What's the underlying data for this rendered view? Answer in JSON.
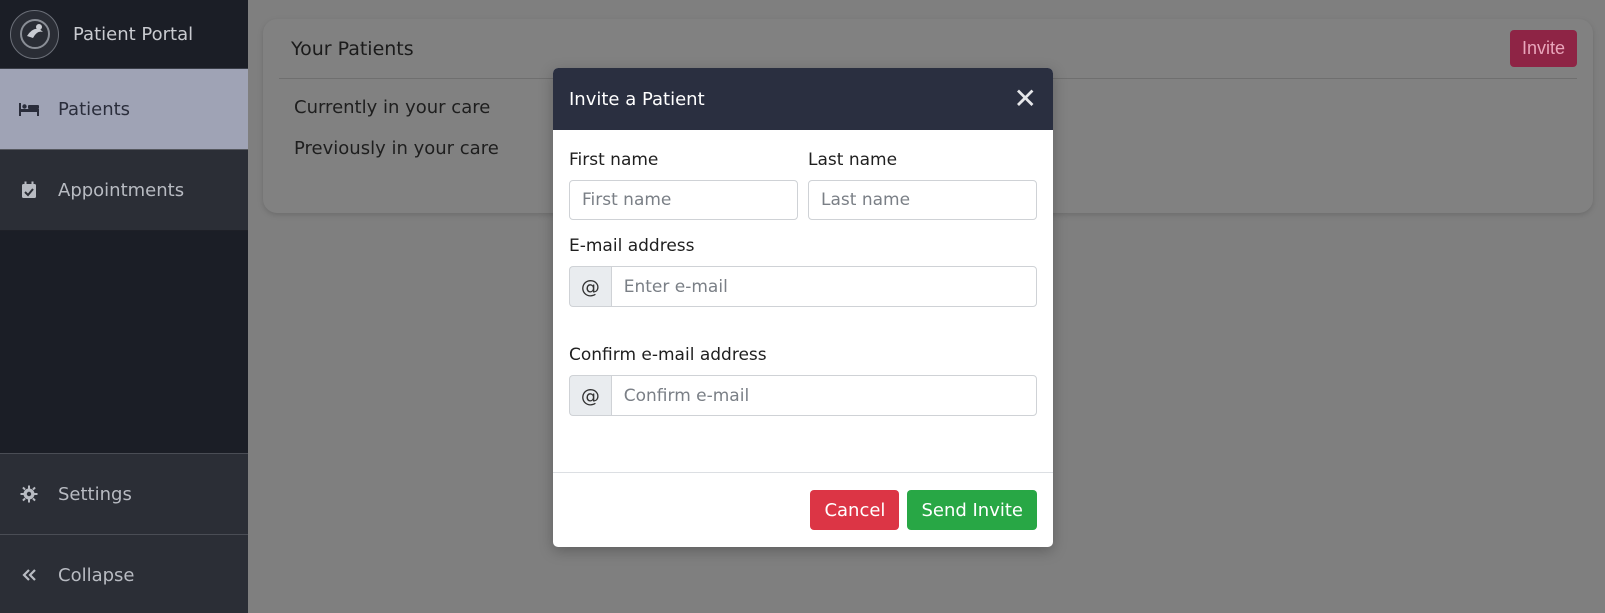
{
  "sidebar": {
    "brand_title": "Patient Portal",
    "items": [
      {
        "label": "Patients",
        "icon": "bed-icon"
      },
      {
        "label": "Appointments",
        "icon": "calendar-check-icon"
      }
    ],
    "bottom_items": [
      {
        "label": "Settings",
        "icon": "gear-icon"
      },
      {
        "label": "Collapse",
        "icon": "double-chevron-left-icon"
      }
    ]
  },
  "main": {
    "title": "Your Patients",
    "invite_label": "Invite",
    "care_items": [
      "Currently in your care",
      "Previously in your care"
    ]
  },
  "modal": {
    "title": "Invite a Patient",
    "first_name_label": "First name",
    "first_name_placeholder": "First name",
    "last_name_label": "Last name",
    "last_name_placeholder": "Last name",
    "email_label": "E-mail address",
    "email_prefix": "@",
    "email_placeholder": "Enter e-mail",
    "confirm_label": "Confirm e-mail address",
    "confirm_prefix": "@",
    "confirm_placeholder": "Confirm e-mail",
    "cancel_label": "Cancel",
    "send_label": "Send Invite"
  },
  "colors": {
    "sidebar_bg": "#1b1e26",
    "modal_header_bg": "#2a2f40",
    "invite_btn": "#8e2445",
    "cancel_btn": "#dc3545",
    "send_btn": "#28a745"
  }
}
